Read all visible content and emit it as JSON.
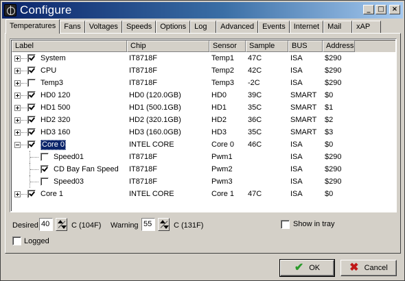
{
  "window": {
    "title": "Configure",
    "buttons": {
      "minimize": "_",
      "maximize": "□",
      "close": "×"
    }
  },
  "tabs": [
    {
      "label": "Temperatures",
      "active": true
    },
    {
      "label": "Fans"
    },
    {
      "label": "Voltages"
    },
    {
      "label": "Speeds"
    },
    {
      "label": "Options"
    },
    {
      "label": "Log"
    },
    {
      "label": "Advanced"
    },
    {
      "label": "Events"
    },
    {
      "label": "Internet"
    },
    {
      "label": "Mail"
    },
    {
      "label": "xAP"
    }
  ],
  "list": {
    "columns": {
      "label": "Label",
      "chip": "Chip",
      "sensor": "Sensor",
      "sample": "Sample",
      "bus": "BUS",
      "address": "Address"
    },
    "rows": [
      {
        "label": "System",
        "chip": "IT8718F",
        "sensor": "Temp1",
        "sample": "47C",
        "bus": "ISA",
        "address": "$290",
        "checked": true,
        "expander": "plus"
      },
      {
        "label": "CPU",
        "chip": "IT8718F",
        "sensor": "Temp2",
        "sample": "42C",
        "bus": "ISA",
        "address": "$290",
        "checked": true,
        "expander": "plus"
      },
      {
        "label": "Temp3",
        "chip": "IT8718F",
        "sensor": "Temp3",
        "sample": "-2C",
        "bus": "ISA",
        "address": "$290",
        "checked": false,
        "expander": "plus"
      },
      {
        "label": "HD0 120",
        "chip": "HD0 (120.0GB)",
        "sensor": "HD0",
        "sample": "39C",
        "bus": "SMART",
        "address": "$0",
        "checked": true,
        "expander": "plus"
      },
      {
        "label": "HD1 500",
        "chip": "HD1 (500.1GB)",
        "sensor": "HD1",
        "sample": "35C",
        "bus": "SMART",
        "address": "$1",
        "checked": true,
        "expander": "plus"
      },
      {
        "label": "HD2 320",
        "chip": "HD2 (320.1GB)",
        "sensor": "HD2",
        "sample": "36C",
        "bus": "SMART",
        "address": "$2",
        "checked": true,
        "expander": "plus"
      },
      {
        "label": "HD3 160",
        "chip": "HD3 (160.0GB)",
        "sensor": "HD3",
        "sample": "35C",
        "bus": "SMART",
        "address": "$3",
        "checked": true,
        "expander": "plus"
      },
      {
        "label": "Core 0",
        "chip": "INTEL CORE",
        "sensor": "Core 0",
        "sample": "46C",
        "bus": "ISA",
        "address": "$0",
        "checked": true,
        "expander": "minus",
        "selected": true
      },
      {
        "label": "Speed01",
        "chip": "IT8718F",
        "sensor": "Pwm1",
        "sample": "",
        "bus": "ISA",
        "address": "$290",
        "checked": false,
        "child": true
      },
      {
        "label": "CD Bay Fan Speed",
        "chip": "IT8718F",
        "sensor": "Pwm2",
        "sample": "",
        "bus": "ISA",
        "address": "$290",
        "checked": true,
        "child": true
      },
      {
        "label": "Speed03",
        "chip": "IT8718F",
        "sensor": "Pwm3",
        "sample": "",
        "bus": "ISA",
        "address": "$290",
        "checked": false,
        "child": true
      },
      {
        "label": "Core 1",
        "chip": "INTEL CORE",
        "sensor": "Core 1",
        "sample": "47C",
        "bus": "ISA",
        "address": "$0",
        "checked": true,
        "expander": "plus"
      }
    ]
  },
  "settings": {
    "desired_label": "Desired",
    "desired_value": "40",
    "desired_unit": "C (104F)",
    "warning_label": "Warning",
    "warning_value": "55",
    "warning_unit": "C (131F)",
    "show_in_tray_label": "Show in tray",
    "logged_label": "Logged"
  },
  "buttons": {
    "ok": "OK",
    "cancel": "Cancel"
  },
  "colors": {
    "title_start": "#0a246a",
    "title_end": "#a6caf0",
    "selection": "#0a246a",
    "ok_icon": "#2a9a2a",
    "cancel_icon": "#c01818"
  }
}
